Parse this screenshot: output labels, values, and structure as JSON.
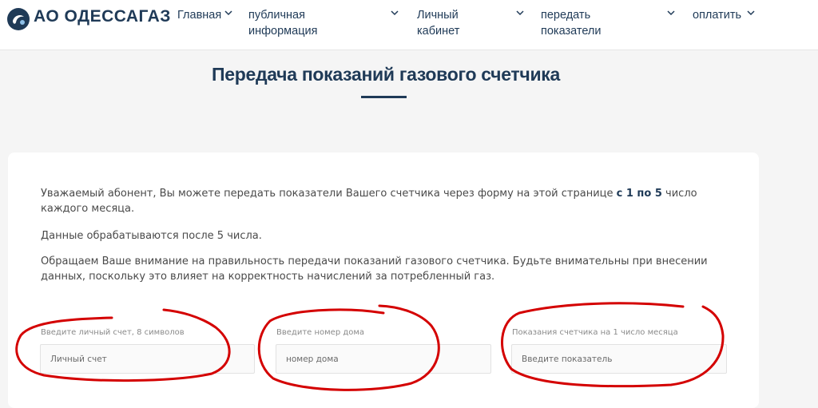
{
  "header": {
    "logo_text": "АО ОДЕССАГАЗ",
    "nav": [
      {
        "label": "Главная"
      },
      {
        "label": "публичная\nинформация"
      },
      {
        "label": "Личный\nкабинет"
      },
      {
        "label": "передать\nпоказатели"
      },
      {
        "label": "оплатить"
      }
    ]
  },
  "page": {
    "title": "Передача показаний газового счетчика"
  },
  "info": {
    "p1_before": "Уважаемый абонент, Вы можете передать показатели Вашего счетчика через форму на этой странице ",
    "p1_bold": "с 1 по 5",
    "p1_after": " число каждого месяца.",
    "p2": "Данные обрабатываются после 5 числа.",
    "p3": "Обращаем Ваше внимание на правильность передачи показаний газового счетчика. Будьте внимательны при внесении данных, поскольку это влияет на корректность начислений за потребленный газ."
  },
  "form": {
    "account": {
      "label": "Введите личный счет, 8 символов",
      "placeholder": "Личный счет",
      "value": ""
    },
    "house": {
      "label": "Введите номер дома",
      "placeholder": "номер дома",
      "value": ""
    },
    "meter": {
      "label": "Показания счетчика на 1 число месяца",
      "placeholder": "Введите показатель",
      "value": ""
    }
  },
  "colors": {
    "brand": "#1f3a57",
    "annotation": "#d40000"
  }
}
